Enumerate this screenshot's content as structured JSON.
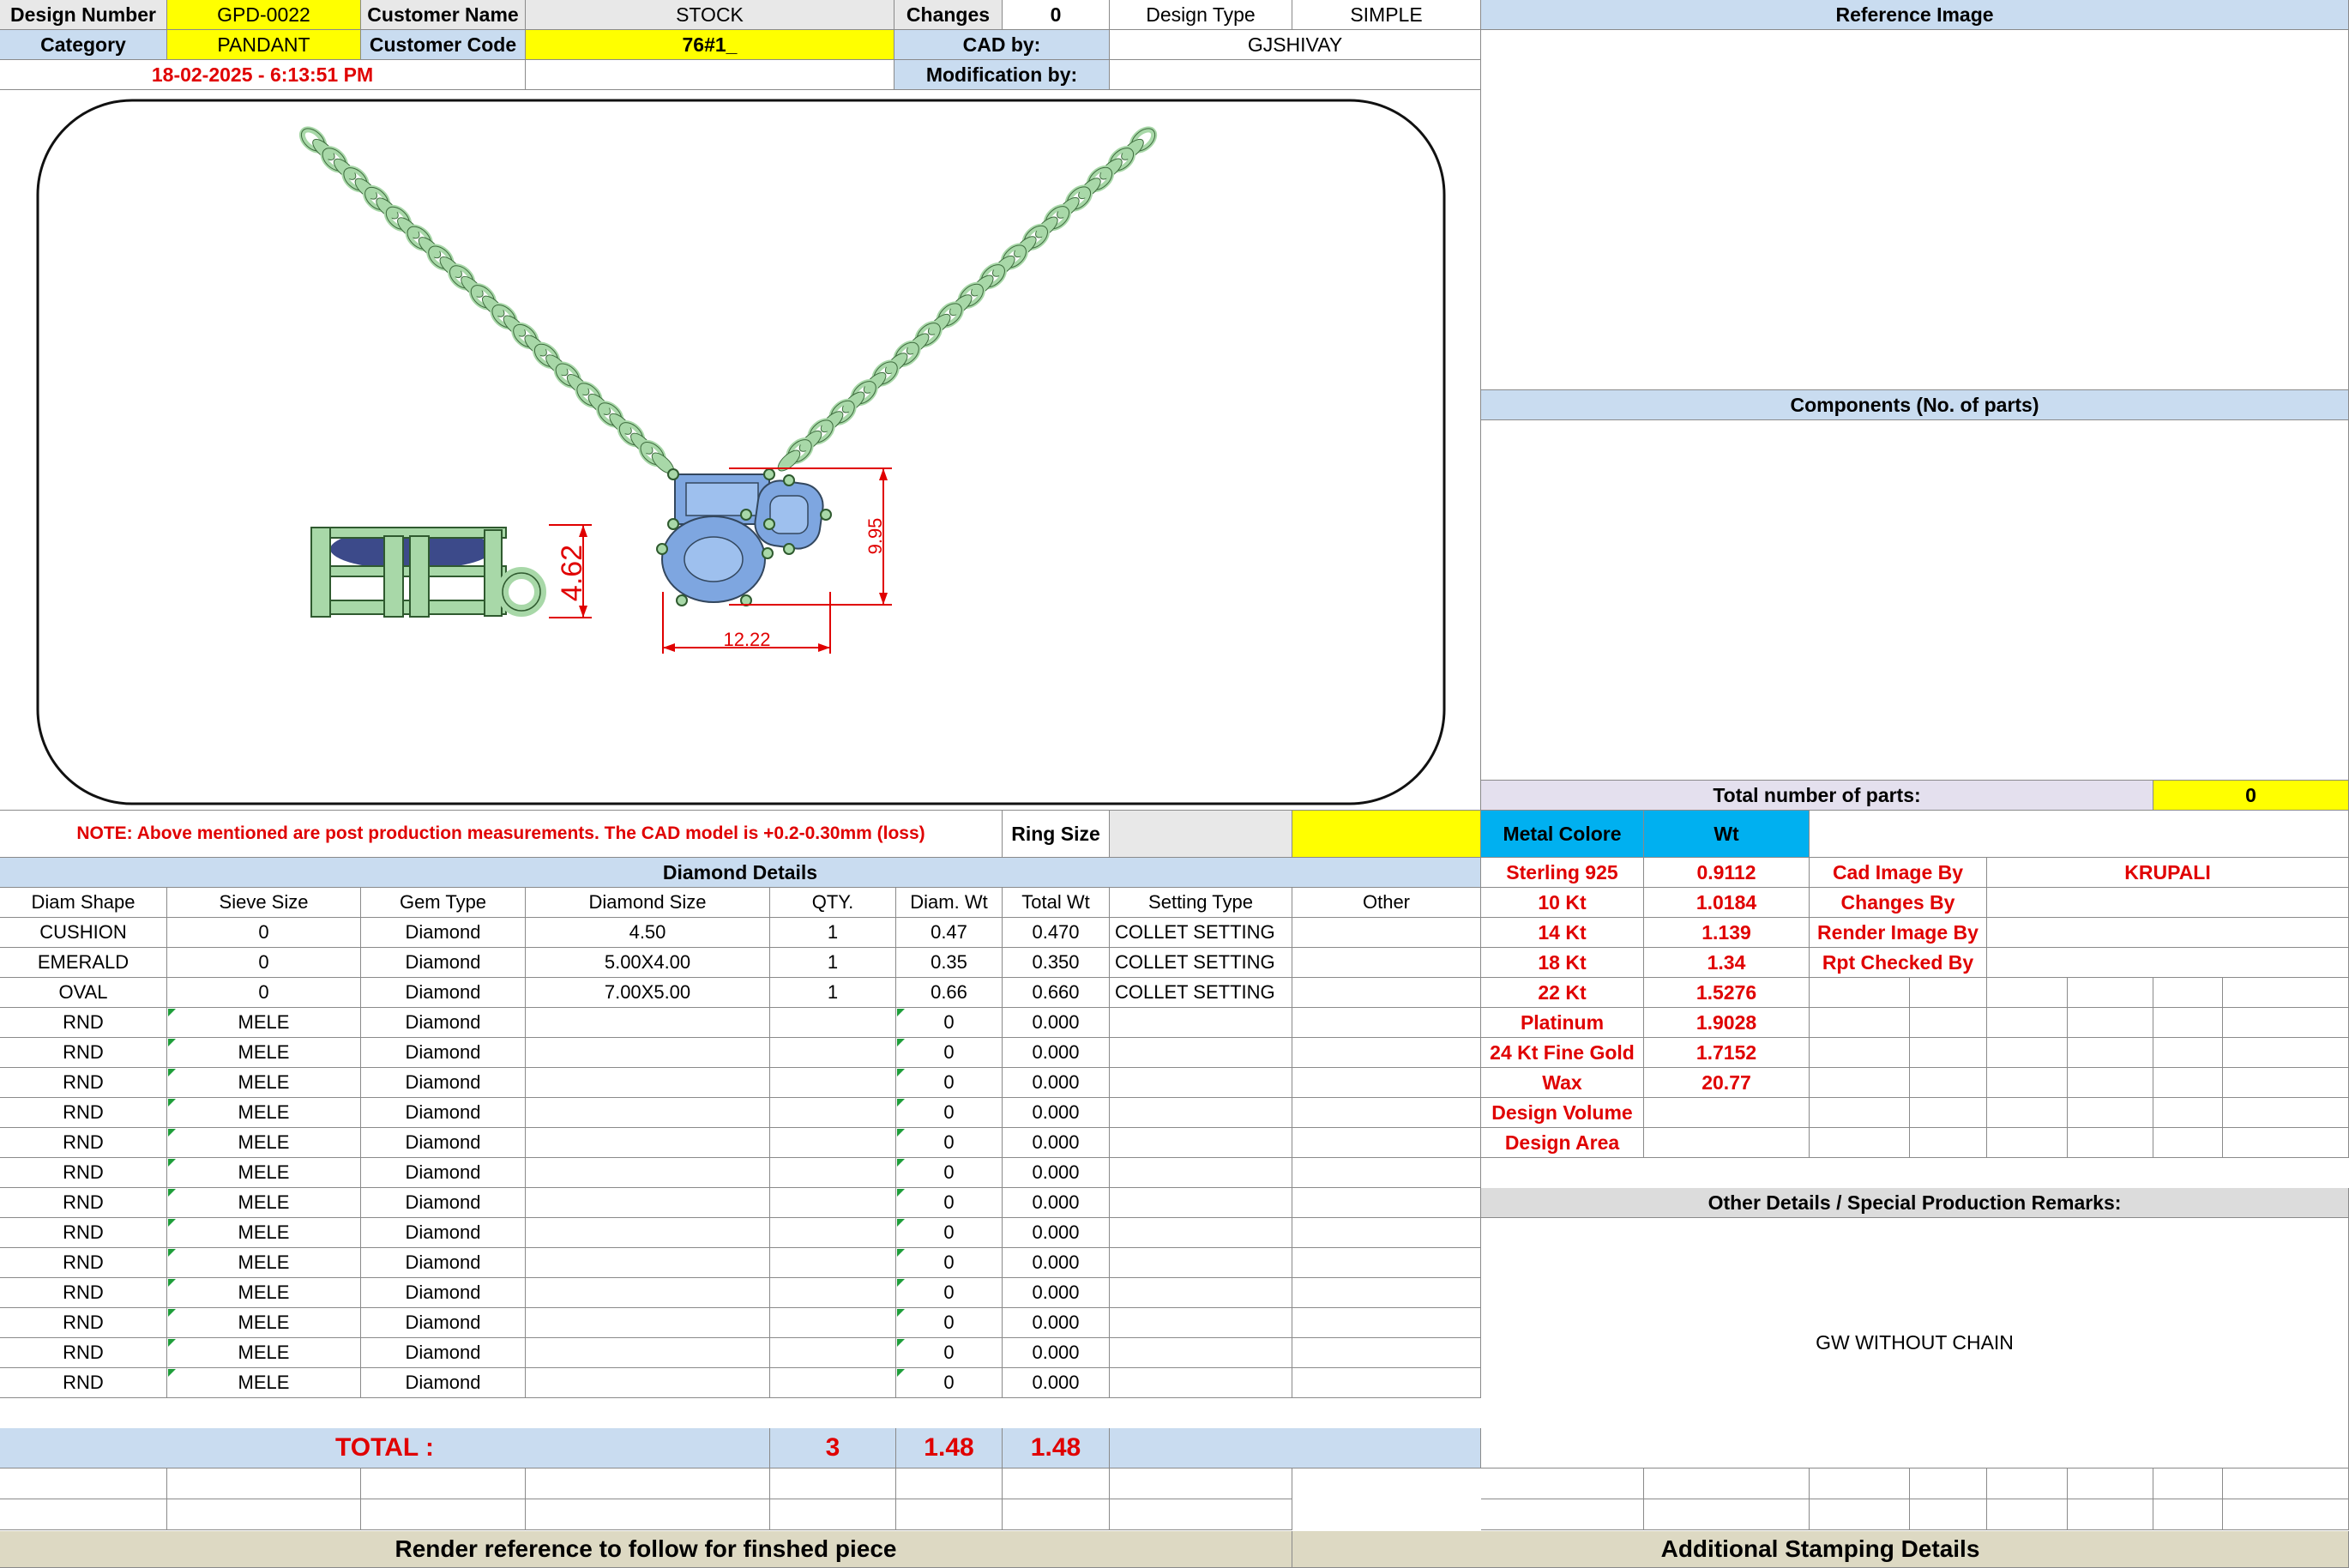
{
  "header": {
    "design_number_label": "Design Number",
    "design_number": "GPD-0022",
    "customer_name_label": "Customer Name",
    "customer_name": "STOCK",
    "changes_label": "Changes",
    "changes": "0",
    "design_type_label": "Design Type",
    "design_type": "SIMPLE",
    "category_label": "Category",
    "category": "PANDANT",
    "customer_code_label": "Customer Code",
    "customer_code": "76#1_",
    "cad_by_label": "CAD by:",
    "cad_by": "GJSHIVAY",
    "datetime": "18-02-2025 - 6:13:51 PM",
    "modification_by_label": "Modification by:",
    "modification_by": ""
  },
  "cad": {
    "dim_height": "4.62",
    "dim_length": "9.95",
    "dim_width": "12.22"
  },
  "reference_image_title": "Reference Image",
  "components_title": "Components (No. of parts)",
  "total_parts_label": "Total number of parts:",
  "total_parts": "0",
  "note": "NOTE: Above mentioned are post production measurements. The CAD model is +0.2-0.30mm (loss)",
  "ring_size_label": "Ring Size",
  "ring_size": "",
  "metal_header": {
    "color": "Metal Colore",
    "wt": "Wt"
  },
  "metals": [
    {
      "name": "Sterling 925",
      "wt": "0.9112"
    },
    {
      "name": "10 Kt",
      "wt": "1.0184"
    },
    {
      "name": "14 Kt",
      "wt": "1.139"
    },
    {
      "name": "18 Kt",
      "wt": "1.34"
    },
    {
      "name": "22 Kt",
      "wt": "1.5276"
    },
    {
      "name": "Platinum",
      "wt": "1.9028"
    },
    {
      "name": "24 Kt Fine Gold",
      "wt": "1.7152"
    },
    {
      "name": "Wax",
      "wt": "20.77"
    },
    {
      "name": "Design Volume",
      "wt": ""
    },
    {
      "name": "Design Area",
      "wt": ""
    }
  ],
  "credits": [
    {
      "label": "Cad Image By",
      "value": "KRUPALI"
    },
    {
      "label": "Changes By",
      "value": ""
    },
    {
      "label": "Render Image By",
      "value": ""
    },
    {
      "label": "Rpt Checked By",
      "value": ""
    }
  ],
  "diamond": {
    "title": "Diamond Details",
    "headers": [
      "Diam Shape",
      "Sieve Size",
      "Gem Type",
      "Diamond Size",
      "QTY.",
      "Diam. Wt",
      "Total Wt",
      "Setting Type",
      "Other"
    ],
    "rows": [
      [
        "CUSHION",
        "0",
        "Diamond",
        "4.50",
        "1",
        "0.47",
        "0.470",
        "COLLET SETTING",
        ""
      ],
      [
        "EMERALD",
        "0",
        "Diamond",
        "5.00X4.00",
        "1",
        "0.35",
        "0.350",
        "COLLET SETTING",
        ""
      ],
      [
        "OVAL",
        "0",
        "Diamond",
        "7.00X5.00",
        "1",
        "0.66",
        "0.660",
        "COLLET SETTING",
        ""
      ],
      [
        "RND",
        "MELE",
        "Diamond",
        "",
        "",
        "0",
        "0.000",
        "",
        ""
      ],
      [
        "RND",
        "MELE",
        "Diamond",
        "",
        "",
        "0",
        "0.000",
        "",
        ""
      ],
      [
        "RND",
        "MELE",
        "Diamond",
        "",
        "",
        "0",
        "0.000",
        "",
        ""
      ],
      [
        "RND",
        "MELE",
        "Diamond",
        "",
        "",
        "0",
        "0.000",
        "",
        ""
      ],
      [
        "RND",
        "MELE",
        "Diamond",
        "",
        "",
        "0",
        "0.000",
        "",
        ""
      ],
      [
        "RND",
        "MELE",
        "Diamond",
        "",
        "",
        "0",
        "0.000",
        "",
        ""
      ],
      [
        "RND",
        "MELE",
        "Diamond",
        "",
        "",
        "0",
        "0.000",
        "",
        ""
      ],
      [
        "RND",
        "MELE",
        "Diamond",
        "",
        "",
        "0",
        "0.000",
        "",
        ""
      ],
      [
        "RND",
        "MELE",
        "Diamond",
        "",
        "",
        "0",
        "0.000",
        "",
        ""
      ],
      [
        "RND",
        "MELE",
        "Diamond",
        "",
        "",
        "0",
        "0.000",
        "",
        ""
      ],
      [
        "RND",
        "MELE",
        "Diamond",
        "",
        "",
        "0",
        "0.000",
        "",
        ""
      ],
      [
        "RND",
        "MELE",
        "Diamond",
        "",
        "",
        "0",
        "0.000",
        "",
        ""
      ],
      [
        "RND",
        "MELE",
        "Diamond",
        "",
        "",
        "0",
        "0.000",
        "",
        ""
      ]
    ],
    "total_label": "TOTAL :",
    "total_qty": "3",
    "total_diam_wt": "1.48",
    "total_wt": "1.48"
  },
  "other_details_title": "Other Details / Special Production Remarks:",
  "remarks": "GW WITHOUT CHAIN",
  "footer": {
    "render_ref": "Render reference to follow for finshed piece",
    "stamping": "Additional Stamping Details"
  },
  "colors": {
    "yellow": "#ffff00",
    "header_blue": "#c9dcf0",
    "metal_cyan": "#00b0f0",
    "footer_beige": "#ddd9c3",
    "red": "#e00000",
    "chain_green": "#a8d8a8",
    "gem_blue": "#7ea6e0"
  }
}
